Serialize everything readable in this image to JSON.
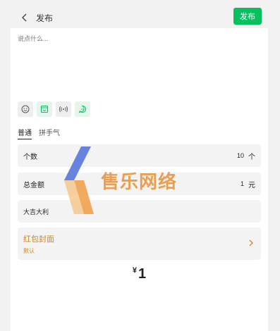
{
  "header": {
    "title": "发布",
    "publish_label": "发布"
  },
  "editor": {
    "placeholder": "说点什么..."
  },
  "tools": [
    "smile-icon",
    "image-icon",
    "audio-icon",
    "chat-icon"
  ],
  "tabs": [
    {
      "label": "普通",
      "active": true
    },
    {
      "label": "拼手气",
      "active": false
    }
  ],
  "form": {
    "count": {
      "label": "个数",
      "value": "10",
      "unit": "个"
    },
    "total": {
      "label": "总金额",
      "value": "1",
      "unit": "元"
    },
    "greeting": "大吉大利"
  },
  "cover": {
    "title": "红包封面",
    "subtitle": "默认"
  },
  "amount": {
    "currency": "¥",
    "value": "1"
  },
  "watermark": {
    "text": "售乐网络"
  },
  "colors": {
    "accent": "#07c160",
    "gold": "#c98a24"
  }
}
